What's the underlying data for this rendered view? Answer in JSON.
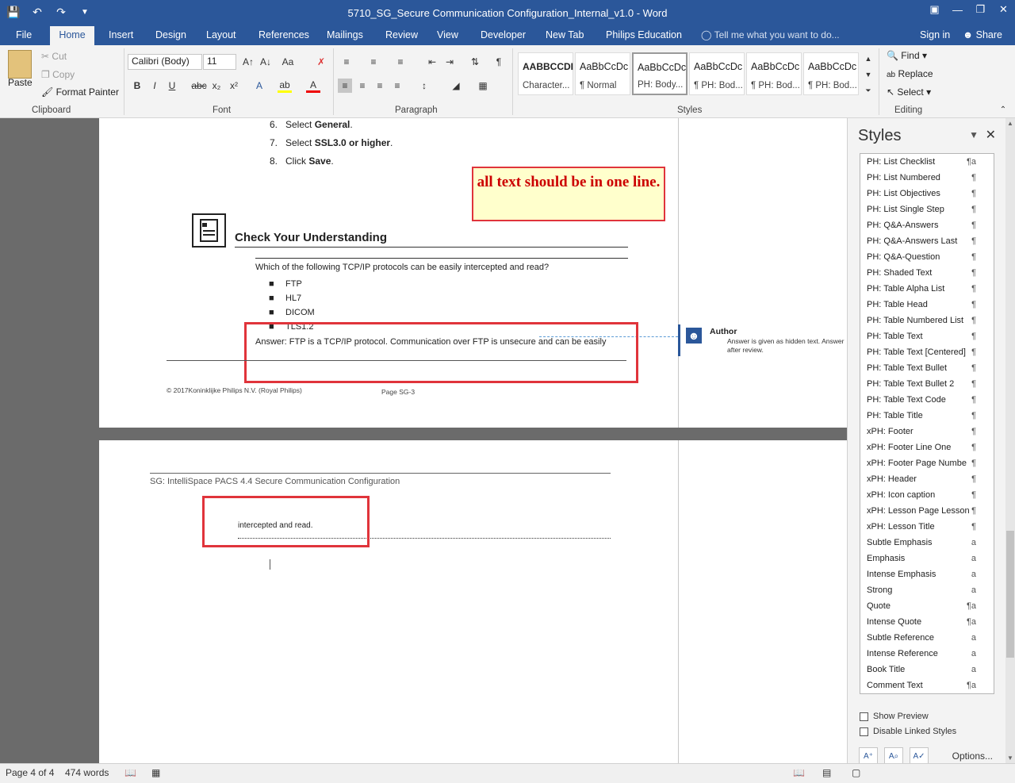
{
  "window": {
    "title": "5710_SG_Secure Communication Configuration_Internal_v1.0 - Word"
  },
  "qat": {
    "save": "Save",
    "undo": "Undo",
    "redo": "Redo",
    "customize": "Customize Quick Access Toolbar"
  },
  "tabs": [
    {
      "label": "File"
    },
    {
      "label": "Home"
    },
    {
      "label": "Insert"
    },
    {
      "label": "Design"
    },
    {
      "label": "Layout"
    },
    {
      "label": "References"
    },
    {
      "label": "Mailings"
    },
    {
      "label": "Review"
    },
    {
      "label": "View"
    },
    {
      "label": "Developer"
    },
    {
      "label": "New Tab"
    },
    {
      "label": "Philips Education"
    }
  ],
  "tellme": "Tell me what you want to do...",
  "signin": "Sign in",
  "share": "Share",
  "clipboard": {
    "paste": "Paste",
    "cut": "Cut",
    "copy": "Copy",
    "format_painter": "Format Painter",
    "label": "Clipboard"
  },
  "font": {
    "name": "Calibri (Body)",
    "size": "11",
    "label": "Font"
  },
  "paragraph": {
    "label": "Paragraph"
  },
  "styles": {
    "label": "Styles",
    "gallery": [
      {
        "sample": "AABBCCDI",
        "name": "Character..."
      },
      {
        "sample": "AaBbCcDc",
        "name": "¶ Normal"
      },
      {
        "sample": "AaBbCcDc",
        "name": "PH: Body..."
      },
      {
        "sample": "AaBbCcDc",
        "name": "¶ PH: Bod..."
      },
      {
        "sample": "AaBbCcDc",
        "name": "¶ PH: Bod..."
      },
      {
        "sample": "AaBbCcDc",
        "name": "¶ PH: Bod..."
      }
    ]
  },
  "editing": {
    "find": "Find",
    "replace": "Replace",
    "select": "Select",
    "label": "Editing"
  },
  "doc": {
    "steps": [
      {
        "num": "6.",
        "pre": "Select ",
        "bold": "General",
        "post": "."
      },
      {
        "num": "7.",
        "pre": "Select ",
        "bold": "SSL3.0 or higher",
        "post": "."
      },
      {
        "num": "8.",
        "pre": "Click ",
        "bold": "Save",
        "post": "."
      }
    ],
    "callout": "all text should be in one line.",
    "section_title": "Check Your Understanding",
    "question": "Which of the following TCP/IP protocols can be easily intercepted and read?",
    "options": [
      "FTP",
      "HL7",
      "DICOM",
      "TLS1.2"
    ],
    "answer": "Answer: FTP is a TCP/IP protocol. Communication over FTP is unsecure and can be easily",
    "footer_left": "© 2017Koninklijke Philips N.V. (Royal Philips)",
    "footer_center": "Page SG-3",
    "comment_author": "Author",
    "comment_text_1": "Answer is given as hidden text. Answer",
    "comment_text_2": "after review.",
    "page2_header": "SG: IntelliSpace PACS 4.4 Secure Communication Configuration",
    "page2_text": "intercepted and read."
  },
  "pane": {
    "title": "Styles",
    "items": [
      {
        "name": "PH: List Checklist",
        "icon": "¶a"
      },
      {
        "name": "PH: List Numbered",
        "icon": "¶"
      },
      {
        "name": "PH: List Objectives",
        "icon": "¶"
      },
      {
        "name": "PH: List Single Step",
        "icon": "¶"
      },
      {
        "name": "PH: Q&A-Answers",
        "icon": "¶"
      },
      {
        "name": "PH: Q&A-Answers Last",
        "icon": "¶"
      },
      {
        "name": "PH: Q&A-Question",
        "icon": "¶"
      },
      {
        "name": "PH: Shaded Text",
        "icon": "¶"
      },
      {
        "name": "PH: Table Alpha List",
        "icon": "¶"
      },
      {
        "name": "PH: Table Head",
        "icon": "¶"
      },
      {
        "name": "PH: Table Numbered List",
        "icon": "¶"
      },
      {
        "name": "PH: Table Text",
        "icon": "¶"
      },
      {
        "name": "PH: Table Text [Centered]",
        "icon": "¶"
      },
      {
        "name": "PH: Table Text Bullet",
        "icon": "¶"
      },
      {
        "name": "PH: Table Text Bullet 2",
        "icon": "¶"
      },
      {
        "name": "PH: Table Text Code",
        "icon": "¶"
      },
      {
        "name": "PH: Table Title",
        "icon": "¶"
      },
      {
        "name": "xPH: Footer",
        "icon": "¶"
      },
      {
        "name": "xPH: Footer Line One",
        "icon": "¶"
      },
      {
        "name": "xPH: Footer Page Numbe",
        "icon": "¶"
      },
      {
        "name": "xPH: Header",
        "icon": "¶"
      },
      {
        "name": "xPH: Icon caption",
        "icon": "¶"
      },
      {
        "name": "xPH: Lesson Page Lesson",
        "icon": "¶"
      },
      {
        "name": "xPH: Lesson Title",
        "icon": "¶"
      },
      {
        "name": "Subtle Emphasis",
        "icon": "a"
      },
      {
        "name": "Emphasis",
        "icon": "a"
      },
      {
        "name": "Intense Emphasis",
        "icon": "a"
      },
      {
        "name": "Strong",
        "icon": "a"
      },
      {
        "name": "Quote",
        "icon": "¶a"
      },
      {
        "name": "Intense Quote",
        "icon": "¶a"
      },
      {
        "name": "Subtle Reference",
        "icon": "a"
      },
      {
        "name": "Intense Reference",
        "icon": "a"
      },
      {
        "name": "Book Title",
        "icon": "a"
      },
      {
        "name": "Comment Text",
        "icon": "¶a"
      }
    ],
    "show_preview": "Show Preview",
    "disable_linked": "Disable Linked Styles",
    "options": "Options..."
  },
  "status": {
    "page": "Page 4 of 4",
    "words": "474 words"
  }
}
